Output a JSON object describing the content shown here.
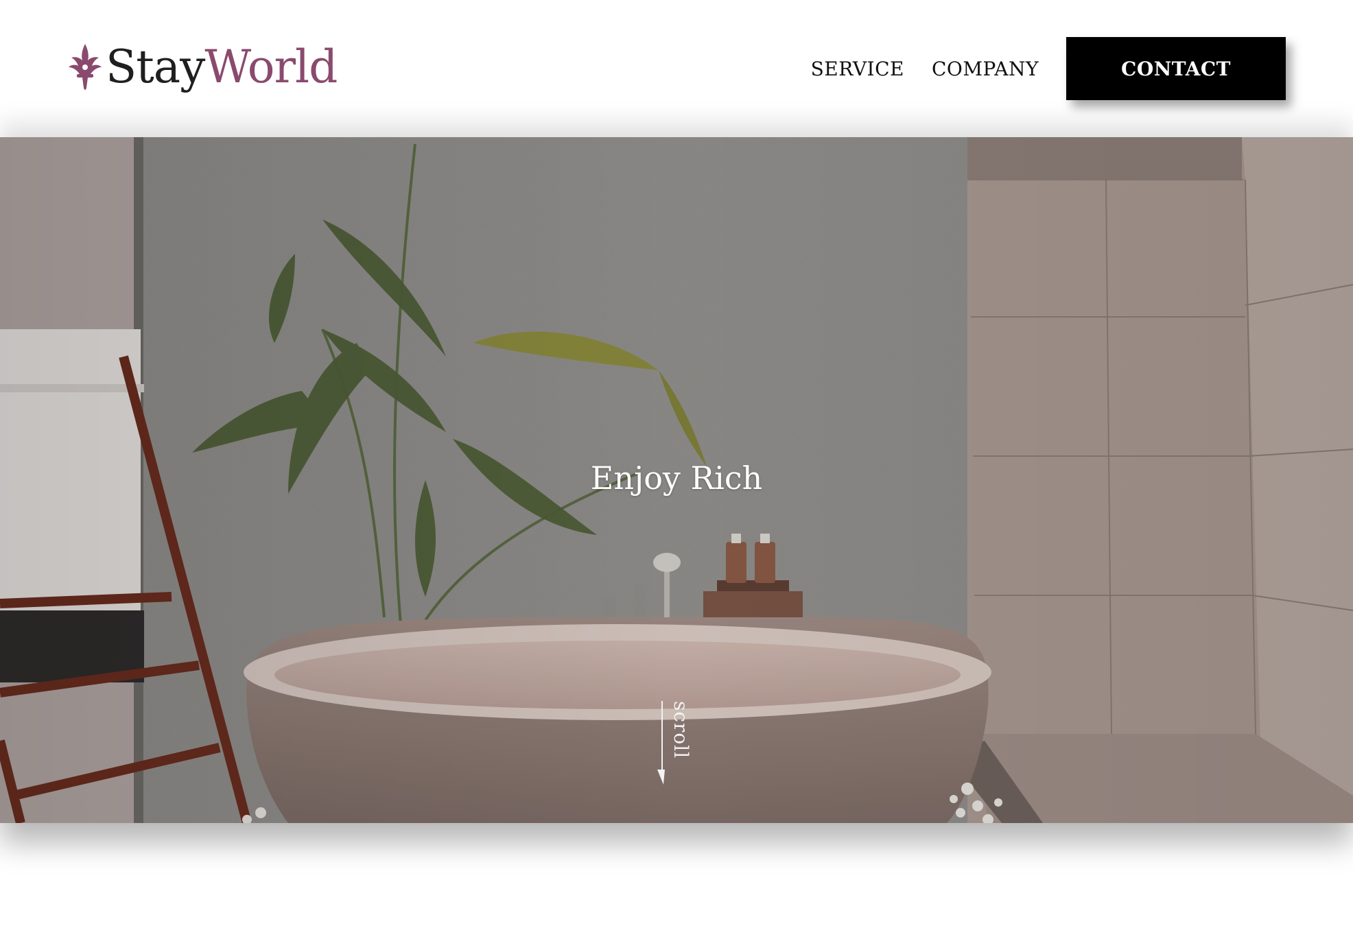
{
  "header": {
    "logo": {
      "part1": "Stay",
      "part2": "World",
      "icon": "fleur-de-lis-icon"
    },
    "nav": {
      "service": "SERVICE",
      "company": "COMPANY",
      "contact": "CONTACT"
    }
  },
  "hero": {
    "title": "Enjoy Rich",
    "scroll_label": "scroll",
    "image": "bathroom-bathtub-palm-photo"
  },
  "colors": {
    "brand": "#8a4a6e",
    "text": "#1f1f1f",
    "button_bg": "#000000",
    "button_text": "#ffffff"
  }
}
